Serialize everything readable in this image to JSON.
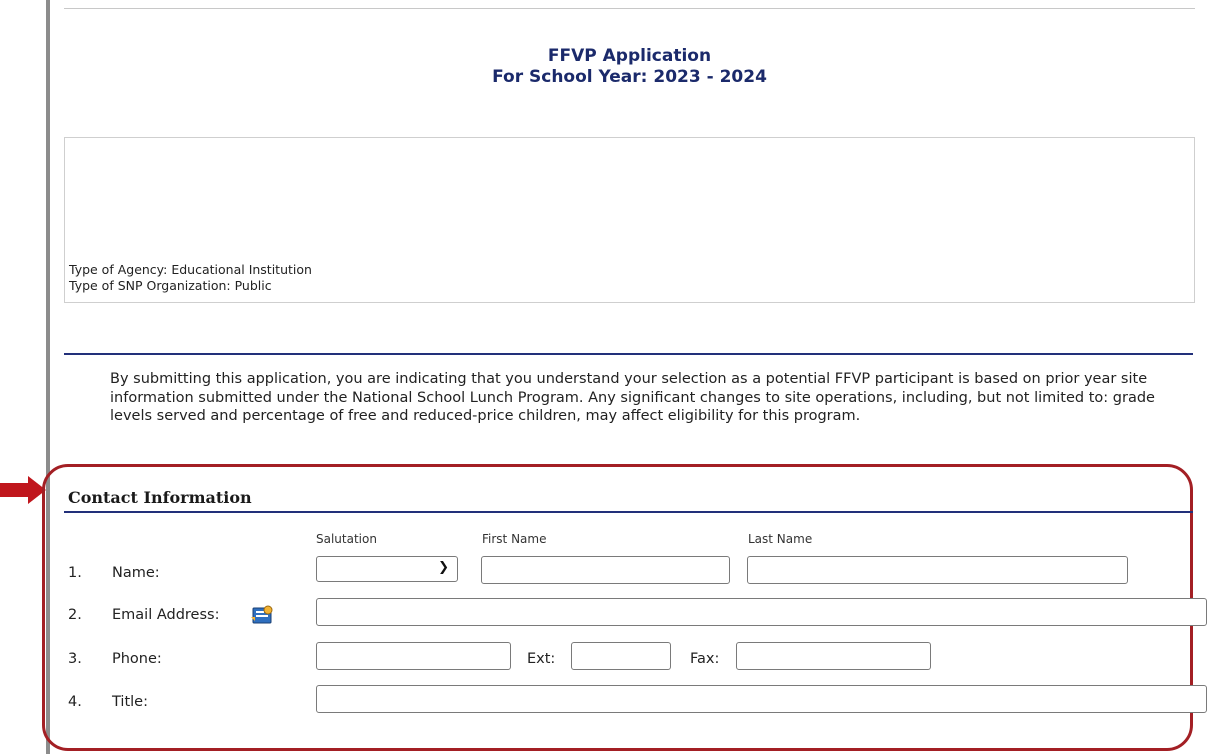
{
  "header": {
    "title": "FFVP Application",
    "subtitle": "For School Year: 2023 - 2024"
  },
  "agency": {
    "type_of_agency": "Type of Agency: Educational Institution",
    "type_of_snp": "Type of SNP Organization: Public"
  },
  "disclaimer": "By submitting this application, you are indicating that you understand your selection as a potential FFVP participant is based on prior year site information submitted under the National School Lunch Program. Any significant changes to site operations, including, but not limited to: grade levels served and percentage of free and reduced-price children, may affect eligibility for this program.",
  "contact": {
    "section_title": "Contact Information",
    "columns": {
      "salutation": "Salutation",
      "first_name": "First Name",
      "last_name": "Last Name"
    },
    "rows": [
      {
        "num": "1.",
        "label": "Name:"
      },
      {
        "num": "2.",
        "label": "Email Address:"
      },
      {
        "num": "3.",
        "label": "Phone:"
      },
      {
        "num": "4.",
        "label": "Title:"
      }
    ],
    "phone_ext_label": "Ext:",
    "fax_label": "Fax:",
    "values": {
      "salutation": "",
      "first_name": "",
      "last_name": "",
      "email": "",
      "phone": "",
      "ext": "",
      "fax": "",
      "title": ""
    }
  },
  "icons": {
    "address_book": "address-book-icon",
    "arrow": "red-arrow-icon",
    "dropdown": "chevron-down-icon"
  },
  "colors": {
    "heading_blue": "#1b2a6b",
    "rule_blue": "#22307a",
    "highlight_red": "#a31f24"
  }
}
